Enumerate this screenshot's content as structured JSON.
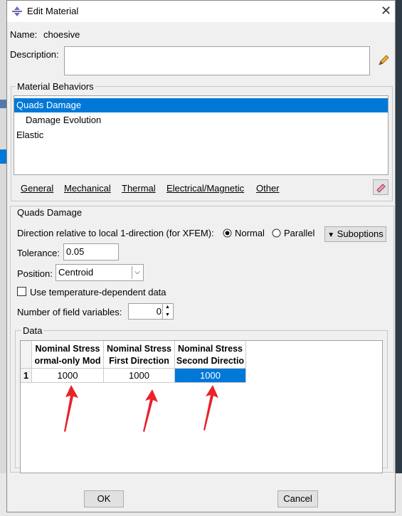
{
  "window": {
    "title": "Edit Material",
    "close_label": "✕"
  },
  "name": {
    "label": "Name:",
    "value": "choesive"
  },
  "description": {
    "label": "Description:",
    "value": ""
  },
  "behaviors": {
    "group_label": "Material Behaviors",
    "items": [
      {
        "label": "Quads Damage",
        "selected": true
      },
      {
        "label": "Damage Evolution",
        "selected": false
      },
      {
        "label": "Elastic",
        "selected": false
      }
    ]
  },
  "menu": {
    "items": [
      "General",
      "Mechanical",
      "Thermal",
      "Electrical/Magnetic",
      "Other"
    ]
  },
  "section": {
    "title": "Quads Damage",
    "direction_label": "Direction relative to local 1-direction (for XFEM):",
    "direction_options": [
      "Normal",
      "Parallel"
    ],
    "direction_selected": "Normal",
    "suboptions_label": "Suboptions",
    "tolerance_label": "Tolerance:",
    "tolerance_value": "0.05",
    "position_label": "Position:",
    "position_value": "Centroid",
    "temp_dependent_label": "Use temperature-dependent data",
    "temp_dependent_checked": false,
    "field_vars_label": "Number of field variables:",
    "field_vars_value": "0"
  },
  "data_table": {
    "group_label": "Data",
    "columns": [
      {
        "line1": "Nominal Stress",
        "line2": "ormal-only Mod"
      },
      {
        "line1": "Nominal Stress",
        "line2": "First Direction"
      },
      {
        "line1": "Nominal Stress",
        "line2": "Second Directio"
      }
    ],
    "rows": [
      {
        "index": "1",
        "values": [
          "1000",
          "1000",
          "1000"
        ]
      }
    ]
  },
  "buttons": {
    "ok": "OK",
    "cancel": "Cancel"
  },
  "colors": {
    "selection": "#0078d7",
    "annotation_arrow": "#e8232a"
  }
}
